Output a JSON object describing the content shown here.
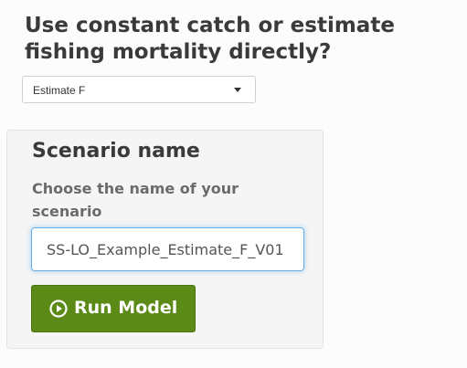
{
  "question": {
    "text": "Use constant catch or estimate fishing mortality directly?"
  },
  "method_select": {
    "selected": "Estimate F",
    "icon": "caret-down-icon"
  },
  "scenario_panel": {
    "title": "Scenario name",
    "label": "Choose the name of your scenario",
    "input_value": "SS-LO_Example_Estimate_F_V01",
    "run_button_label": "Run Model",
    "run_button_icon": "play-circle-icon",
    "run_button_color": "#5b8a16"
  }
}
